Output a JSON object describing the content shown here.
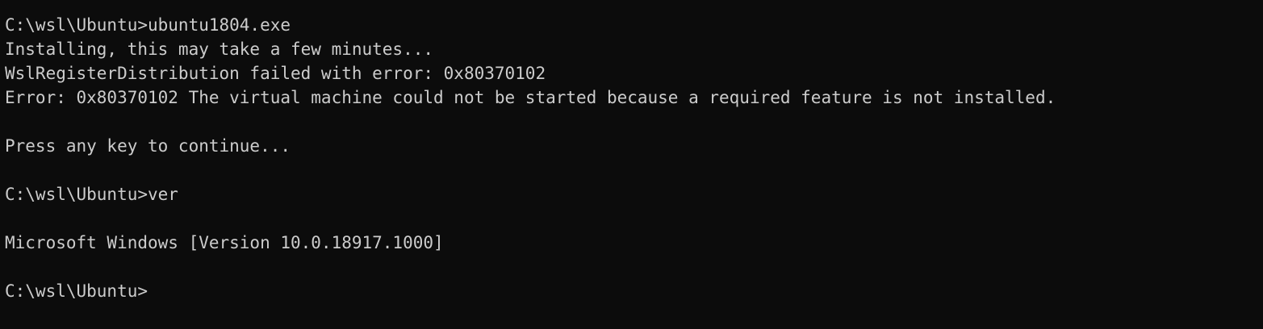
{
  "terminal": {
    "lines": [
      "C:\\wsl\\Ubuntu>ubuntu1804.exe",
      "Installing, this may take a few minutes...",
      "WslRegisterDistribution failed with error: 0x80370102",
      "Error: 0x80370102 The virtual machine could not be started because a required feature is not installed.",
      "",
      "Press any key to continue...",
      "",
      "C:\\wsl\\Ubuntu>ver",
      "",
      "Microsoft Windows [Version 10.0.18917.1000]",
      "",
      "C:\\wsl\\Ubuntu>"
    ]
  }
}
